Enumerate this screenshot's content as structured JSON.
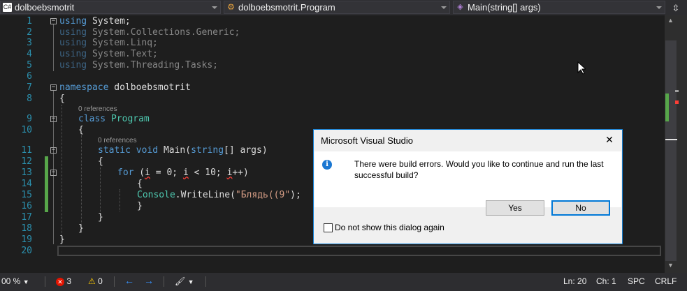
{
  "navbar": {
    "project": "dolboebsmotrit",
    "project_icon": "C#",
    "class": "dolboebsmotrit.Program",
    "member": "Main(string[] args)"
  },
  "editor": {
    "line_numbers": [
      "1",
      "2",
      "3",
      "4",
      "5",
      "6",
      "7",
      "8",
      "9",
      "10",
      "11",
      "12",
      "13",
      "14",
      "15",
      "16",
      "17",
      "18",
      "19",
      "20"
    ],
    "codelens_program": "0 references",
    "codelens_main": "0 references",
    "lines": {
      "l1_kw": "using",
      "l1_rest": " System;",
      "l2_kw": "using",
      "l2_rest": " System.Collections.Generic;",
      "l3_kw": "using",
      "l3_rest": " System.Linq;",
      "l4_kw": "using",
      "l4_rest": " System.Text;",
      "l5_kw": "using",
      "l5_rest": " System.Threading.Tasks;",
      "l7_kw": "namespace",
      "l7_rest": " dolboebsmotrit",
      "l8": "{",
      "l9_kw": "class",
      "l9_ty": "Program",
      "l10": "{",
      "l11_kw1": "static",
      "l11_kw2": "void",
      "l11_name": "Main(",
      "l11_kw3": "string",
      "l11_rest": "[] args)",
      "l12": "{",
      "l13_kw": "for",
      "l13_a": " (",
      "l13_i1": "i",
      "l13_b": " = 0; ",
      "l13_i2": "i",
      "l13_c": " < 10; ",
      "l13_i3": "i",
      "l13_d": "++)",
      "l14": "{",
      "l15_ty": "Console",
      "l15_a": ".WriteLine(",
      "l15_str": "\"Блядь((9\"",
      "l15_b": ");",
      "l16": "}",
      "l17": "}",
      "l18": "}",
      "l19": "}"
    }
  },
  "statusbar": {
    "zoom": "00 %",
    "errors": "3",
    "warnings": "0",
    "line": "Ln: 20",
    "col": "Ch: 1",
    "spacing": "SPC",
    "line_ending": "CRLF"
  },
  "dialog": {
    "title": "Microsoft Visual Studio",
    "close": "✕",
    "message": "There were build errors. Would you like to continue and run the last successful build?",
    "yes_label": "Yes",
    "no_label": "No",
    "checkbox_label": "Do not show this dialog again"
  },
  "colors": {
    "keyword": "#569cd6",
    "type": "#4ec9b0",
    "string": "#d69d85",
    "line_number": "#2b91af",
    "accent": "#0078d7"
  }
}
